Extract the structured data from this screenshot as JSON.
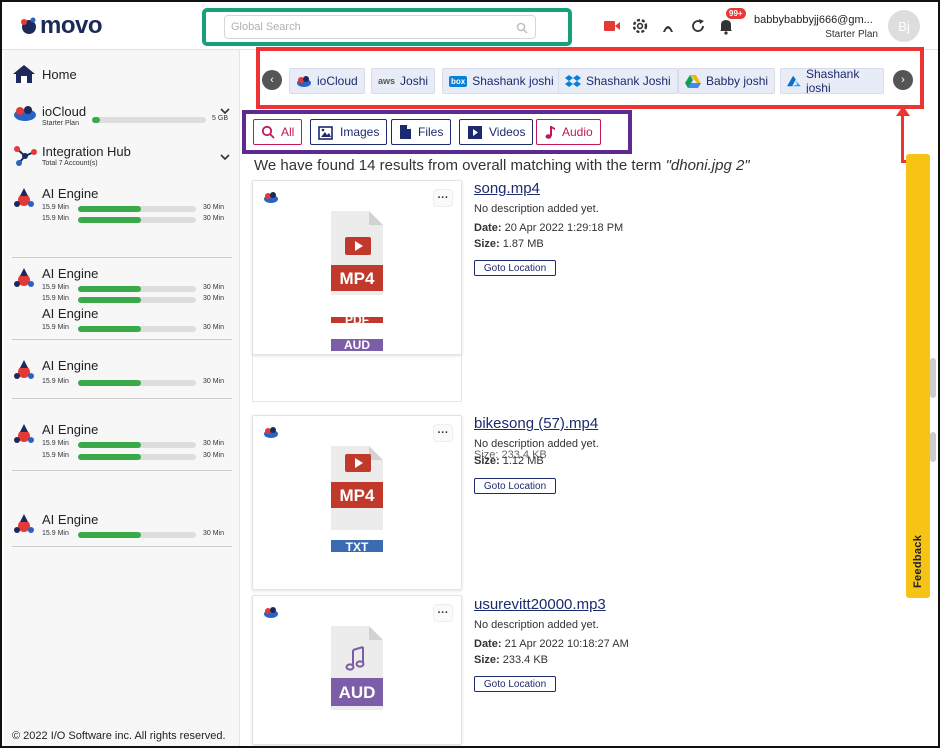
{
  "header": {
    "logo_text": "movo",
    "search_placeholder": "Global Search",
    "notifications_count": "99+",
    "user_email": "babbybabbyjj666@gm...",
    "user_plan": "Starter Plan",
    "avatar_initials": "Bj"
  },
  "sidebar": {
    "home_label": "Home",
    "iocloud": {
      "title": "ioCloud",
      "plan": "Starter Plan",
      "storage_max": "5 GB",
      "storage_used_fraction": 0.07
    },
    "integration": {
      "title": "Integration Hub",
      "subtitle": "Total 7 Account(s)"
    },
    "ai_engines": [
      {
        "title": "AI Engine",
        "rows": [
          {
            "label": "15.9 Min",
            "max": "30 Min"
          },
          {
            "label": "15.9 Min",
            "max": "30 Min"
          }
        ]
      },
      {
        "title": "AI Engine",
        "rows": [
          {
            "label": "15.9 Min",
            "max": "30 Min"
          },
          {
            "label": "15.9 Min",
            "max": "30 Min"
          }
        ]
      },
      {
        "title": "AI Engine",
        "rows": [
          {
            "label": "15.9 Min",
            "max": "30 Min"
          }
        ]
      },
      {
        "title": "AI Engine",
        "rows": [
          {
            "label": "15.9 Min",
            "max": "30 Min"
          }
        ]
      },
      {
        "title": "AI Engine",
        "rows": [
          {
            "label": "15.9 Min",
            "max": "30 Min"
          },
          {
            "label": "15.9 Min",
            "max": "30 Min"
          }
        ]
      },
      {
        "title": "AI Engine",
        "rows": [
          {
            "label": "15.9 Min",
            "max": "30 Min"
          }
        ]
      }
    ],
    "ai_fill_fraction": 0.53,
    "copyright": "© 2022 I/O Software inc. All rights reserved."
  },
  "providers": [
    {
      "label": "ioCloud",
      "icon": "iocloud-icon"
    },
    {
      "label": "Joshi",
      "icon": "aws-icon"
    },
    {
      "label": "Shashank joshi",
      "icon": "box-icon"
    },
    {
      "label": "Shashank Joshi",
      "icon": "dropbox-icon"
    },
    {
      "label": "Babby joshi",
      "icon": "google-drive-icon"
    },
    {
      "label": "Shashank joshi",
      "icon": "azure-icon"
    }
  ],
  "filters": [
    {
      "label": "All",
      "icon": "search-icon"
    },
    {
      "label": "Images",
      "icon": "image-icon"
    },
    {
      "label": "Files",
      "icon": "file-icon"
    },
    {
      "label": "Videos",
      "icon": "video-icon"
    },
    {
      "label": "Audio",
      "icon": "music-note-icon"
    }
  ],
  "results": {
    "summary": "We have found 14 results from overall matching with the term ",
    "term": "\"dhoni.jpg 2\"",
    "items": [
      {
        "title": "song.mp4",
        "description": "No description added yet.",
        "date_label": "Date:",
        "date": "20 Apr 2022 1:29:18 PM",
        "size_label": "Size:",
        "size": "1.87 MB",
        "badge": "MP4",
        "goto": "Goto Location"
      },
      {
        "title": "bikesong (57).mp4",
        "description": "No description added yet.",
        "size_label": "Size:",
        "size": "1.12 MB",
        "ghost_size": "Size: 233.4 KB",
        "badge": "MP4",
        "ghost_badge": "TXT",
        "goto": "Goto Location"
      },
      {
        "title": "usurevitt20000.mp3",
        "description": "No description added yet.",
        "date_label": "Date:",
        "date": "21 Apr 2022 10:18:27 AM",
        "size_label": "Size:",
        "size": "233.4 KB",
        "badge": "AUD",
        "goto": "Goto Location"
      }
    ],
    "ghost_badges": [
      "PDF",
      "AUD"
    ]
  },
  "feedback_label": "Feedback",
  "colors": {
    "accent_blue": "#1c2a6e",
    "green": "#3aaa48",
    "red": "#c2185b",
    "mp4_red": "#c0392b",
    "aud_purple": "#7b5ea7",
    "feedback_yellow": "#f7c416"
  }
}
